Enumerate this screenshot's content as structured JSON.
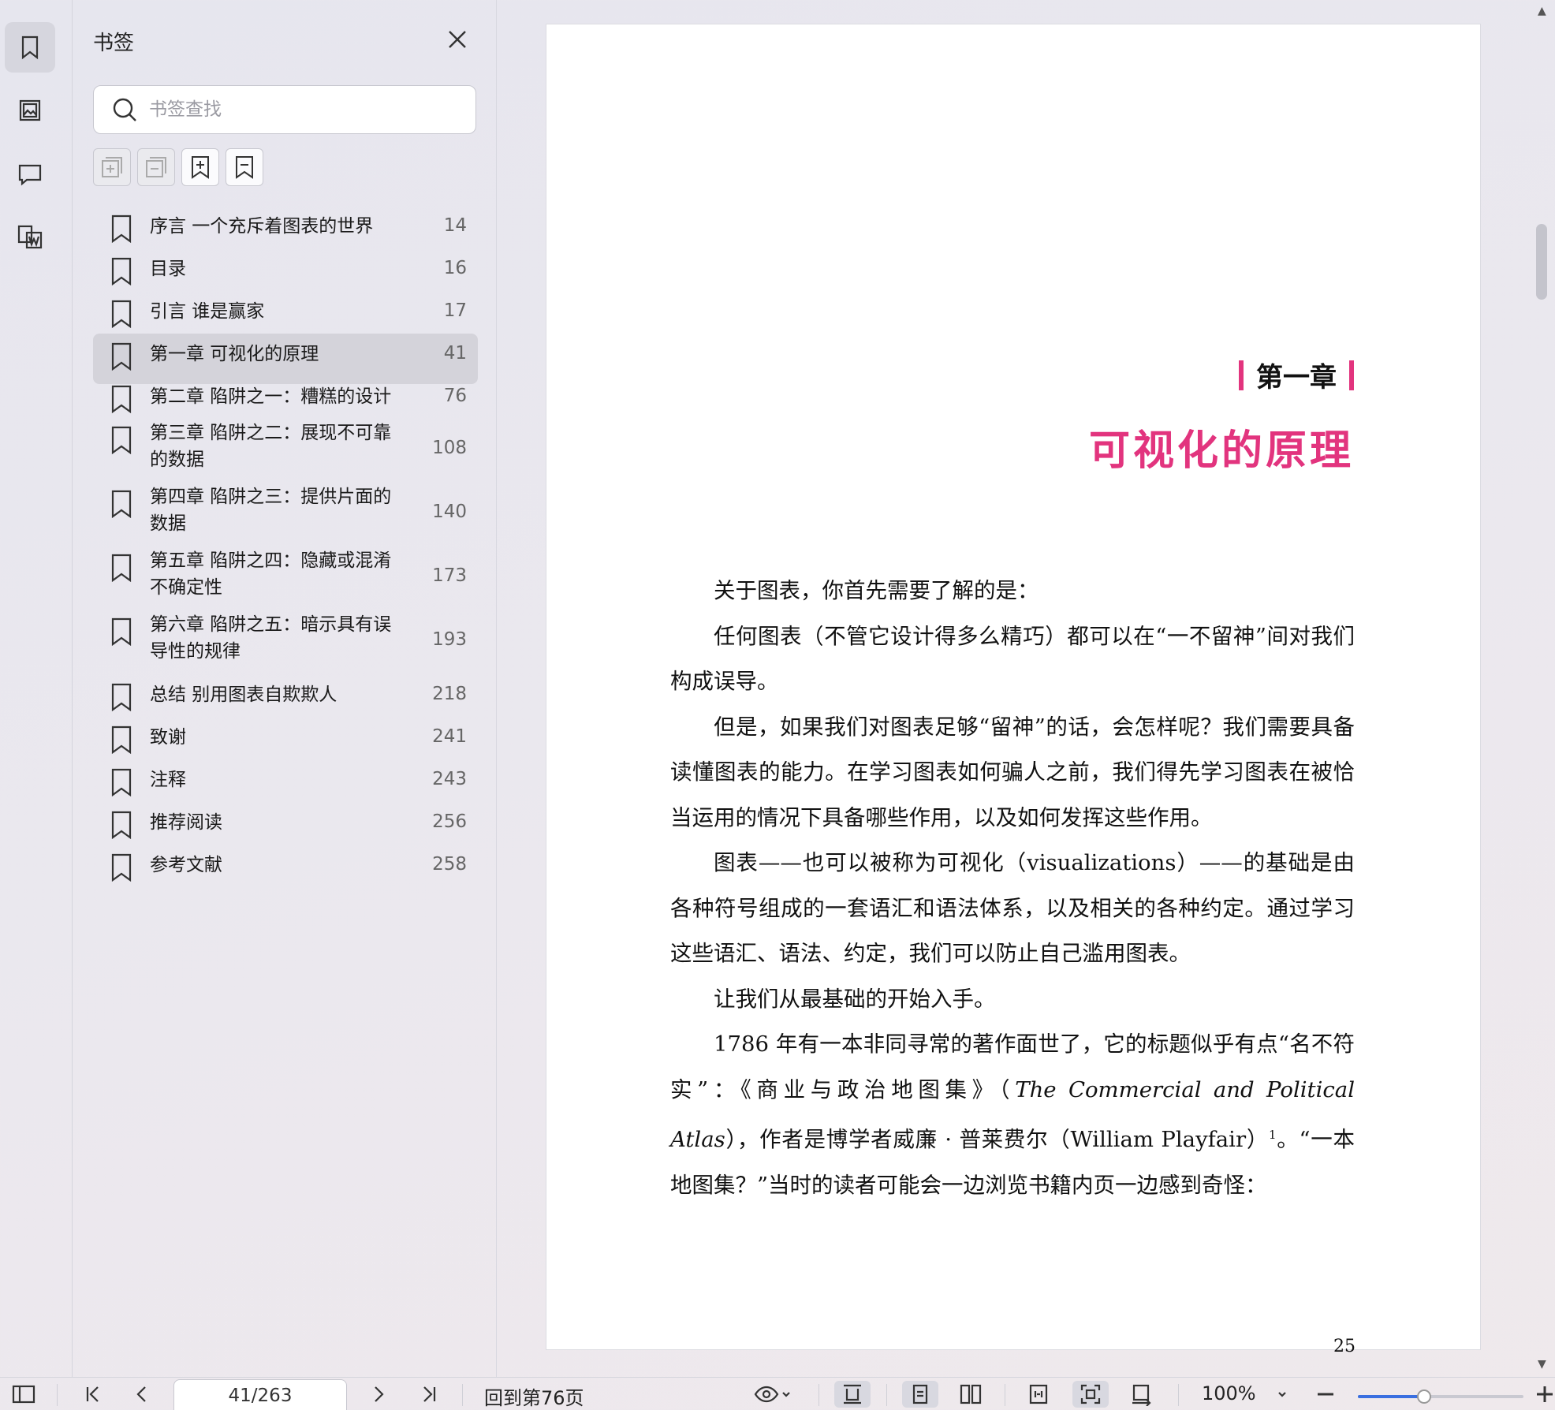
{
  "rail": {
    "items": [
      {
        "name": "bookmarks",
        "icon": "bookmark-icon",
        "active": true
      },
      {
        "name": "thumbnails",
        "icon": "image-icon",
        "active": false
      },
      {
        "name": "comments",
        "icon": "comment-icon",
        "active": false
      },
      {
        "name": "convert",
        "icon": "word-convert-icon",
        "active": false
      }
    ]
  },
  "panel": {
    "title": "书签",
    "search_placeholder": "书签查找",
    "tools": [
      {
        "name": "expand-all",
        "icon": "expand-all-icon",
        "disabled": true
      },
      {
        "name": "collapse-all",
        "icon": "collapse-all-icon",
        "disabled": true
      },
      {
        "name": "add-bookmark",
        "icon": "add-bookmark-icon",
        "disabled": false
      },
      {
        "name": "remove-bookmark",
        "icon": "remove-bookmark-icon",
        "disabled": false
      }
    ],
    "bookmarks": [
      {
        "label": "序言 一个充斥着图表的世界",
        "page": "14"
      },
      {
        "label": "目录",
        "page": "16"
      },
      {
        "label": "引言 谁是赢家",
        "page": "17"
      },
      {
        "label": "第一章 可视化的原理",
        "page": "41",
        "active": true
      },
      {
        "label": "第二章 陷阱之一：糟糕的设计",
        "page": "76"
      },
      {
        "label": "第三章 陷阱之二：展现不可靠的数据",
        "page": "108",
        "wrap": true
      },
      {
        "label": "第四章 陷阱之三：提供片面的数据",
        "page": "140",
        "wrap": true
      },
      {
        "label": "第五章 陷阱之四：隐藏或混淆不确定性",
        "page": "173",
        "wrap": true
      },
      {
        "label": "第六章 陷阱之五：暗示具有误导性的规律",
        "page": "193",
        "wrap": true
      },
      {
        "label": "总结 别用图表自欺欺人",
        "page": "218"
      },
      {
        "label": "致谢",
        "page": "241"
      },
      {
        "label": "注释",
        "page": "243"
      },
      {
        "label": "推荐阅读",
        "page": "256"
      },
      {
        "label": "参考文献",
        "page": "258"
      }
    ]
  },
  "page": {
    "chapter_number": "第一章",
    "chapter_title": "可视化的原理",
    "paragraphs": [
      "关于图表，你首先需要了解的是：",
      "任何图表（不管它设计得多么精巧）都可以在“一不留神”间对我们构成误导。",
      "但是，如果我们对图表足够“留神”的话，会怎样呢？我们需要具备读懂图表的能力。在学习图表如何骗人之前，我们得先学习图表在被恰当运用的情况下具备哪些作用，以及如何发挥这些作用。",
      "图表——也可以被称为可视化（visualizations）——的基础是由各种符号组成的一套语汇和语法体系，以及相关的各种约定。通过学习这些语汇、语法、约定，我们可以防止自己滥用图表。",
      "让我们从最基础的开始入手。"
    ],
    "last_paragraph": {
      "part1": "1786 年有一本非同寻常的著作面世了，它的标题似乎有点“名不符实”：《商业与政治地图集》（",
      "italic": "The Commercial and Political Atlas",
      "part2": "），作者是博学者威廉 · 普莱费尔（William Playfair）",
      "sup": "1",
      "part3": "。“一本地图集？”当时的读者可能会一边浏览书籍内页一边感到奇怪："
    },
    "page_number": "25"
  },
  "statusbar": {
    "page_field": "41/263",
    "back_to": "回到第76页",
    "zoom": "100%",
    "zoom_fraction": 0.4
  }
}
